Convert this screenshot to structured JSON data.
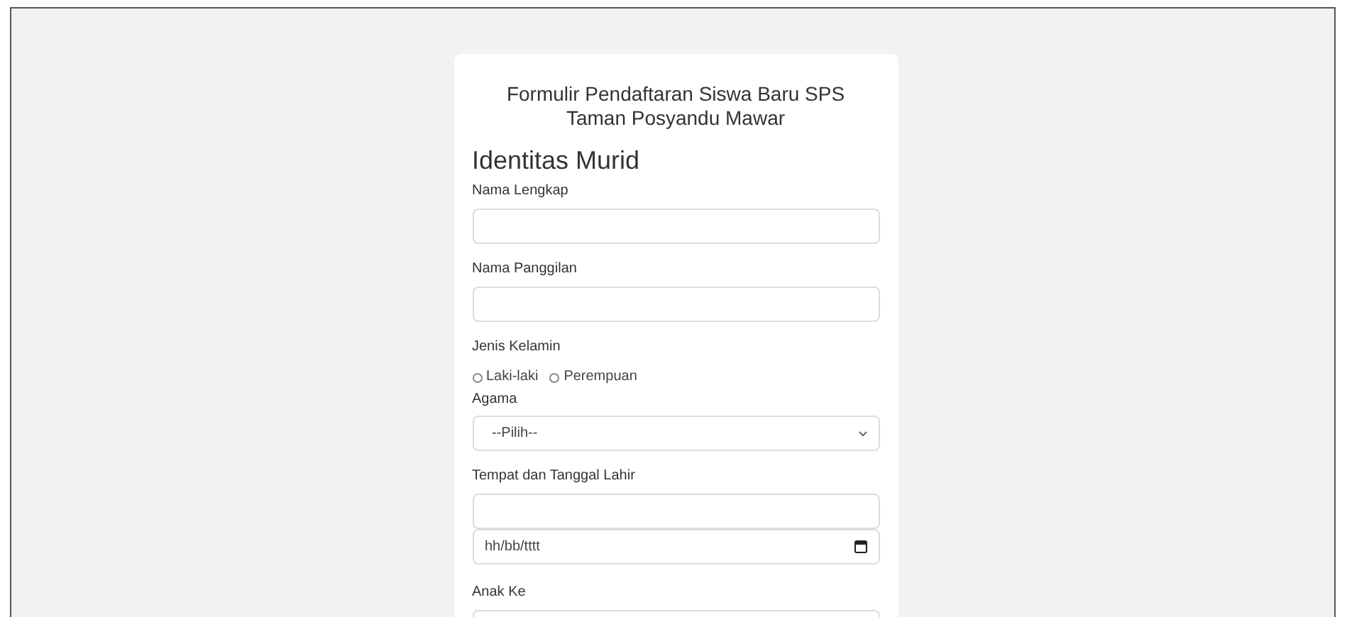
{
  "form": {
    "title": "Formulir Pendaftaran Siswa Baru SPS Taman Posyandu Mawar",
    "section": "Identitas Murid",
    "fields": [
      {
        "kind": "text",
        "label": "Nama Lengkap"
      },
      {
        "kind": "text",
        "label": "Nama Panggilan"
      },
      {
        "kind": "radio",
        "label": "Jenis Kelamin",
        "options": [
          {
            "label": "Laki-laki",
            "selected": false
          },
          {
            "label": "Perempuan",
            "selected": false
          }
        ]
      },
      {
        "kind": "select",
        "label": "Agama",
        "value": "--Pilih--"
      },
      {
        "kind": "text_date",
        "label": "Tempat dan Tanggal Lahir",
        "date_placeholder": "hh/bb/tttt"
      },
      {
        "kind": "text",
        "label": "Anak Ke"
      }
    ]
  }
}
